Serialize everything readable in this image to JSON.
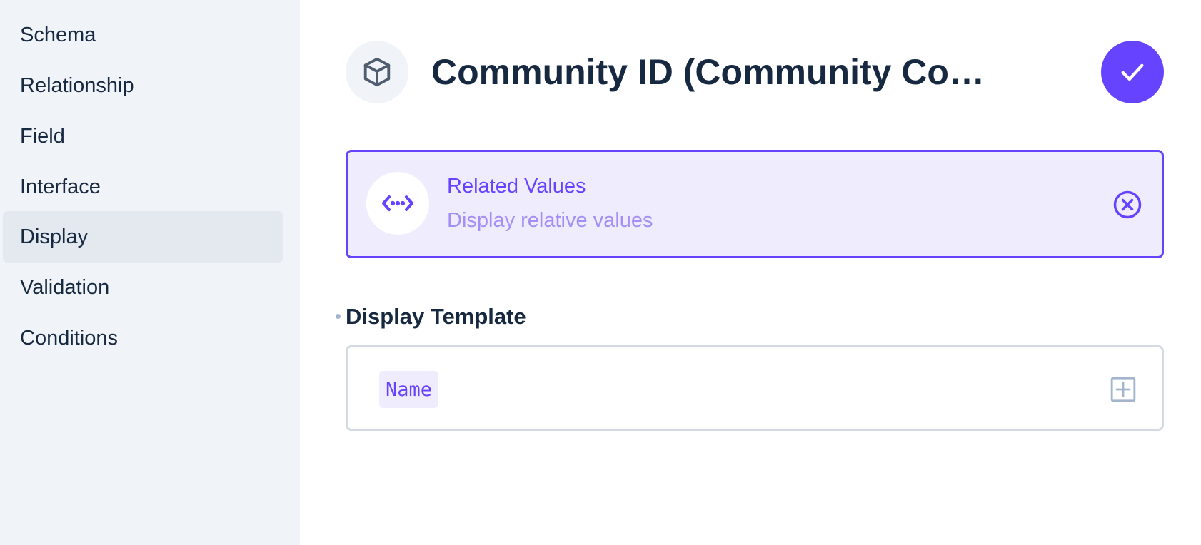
{
  "sidebar": {
    "items": [
      {
        "label": "Schema"
      },
      {
        "label": "Relationship"
      },
      {
        "label": "Field"
      },
      {
        "label": "Interface"
      },
      {
        "label": "Display",
        "active": true
      },
      {
        "label": "Validation"
      },
      {
        "label": "Conditions"
      }
    ]
  },
  "header": {
    "title": "Community ID (Community Co…",
    "icon": "cube-icon",
    "save_icon": "check-icon"
  },
  "display": {
    "title": "Related Values",
    "subtitle": "Display relative values",
    "icon": "code-arrows-icon",
    "clear_icon": "close-circle-icon"
  },
  "template_field": {
    "label": "Display Template",
    "required": true,
    "tokens": [
      "Name"
    ],
    "add_icon": "add-box-icon"
  },
  "colors": {
    "accent": "#6644ff",
    "accent_light": "#efecfd",
    "sidebar_bg": "#f0f4f9",
    "sidebar_active": "#e4e9f0",
    "text": "#172940",
    "border": "#d3dae4"
  }
}
